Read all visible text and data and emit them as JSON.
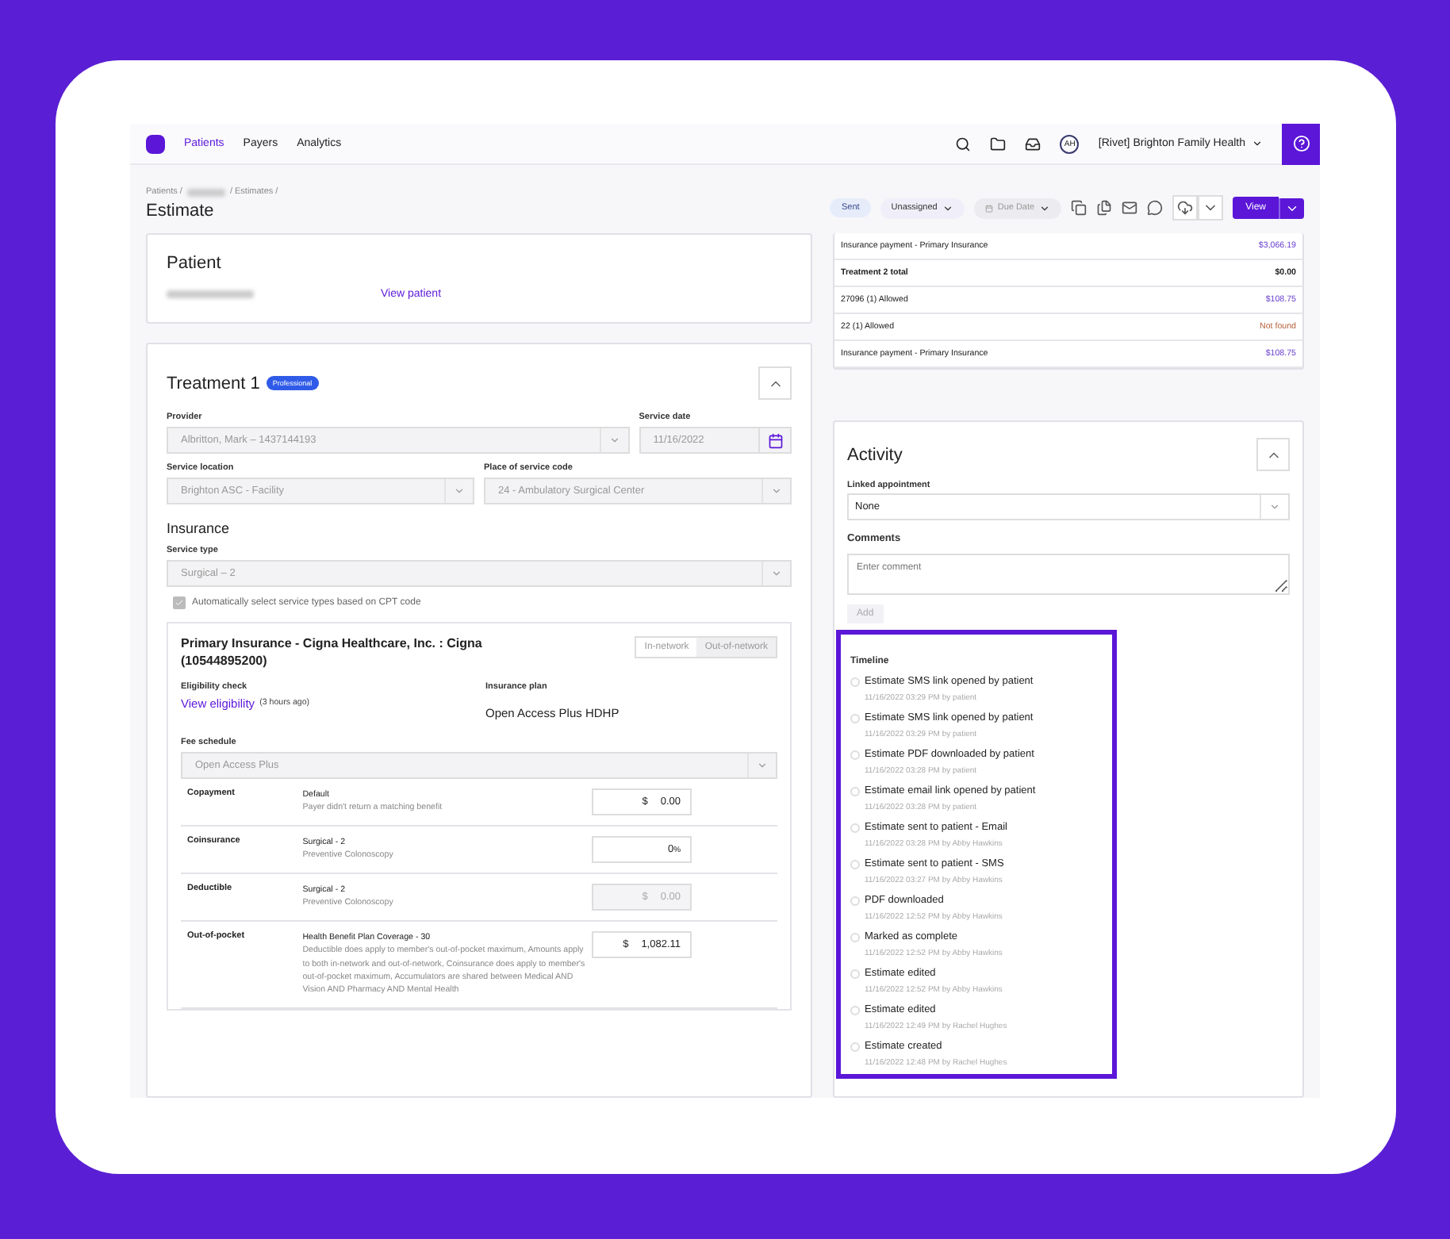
{
  "nav": {
    "items": [
      {
        "label": "Patients",
        "selected": true
      },
      {
        "label": "Payers",
        "selected": false
      },
      {
        "label": "Analytics",
        "selected": false
      }
    ],
    "org": {
      "initials": "AH",
      "name": "[Rivet] Brighton Family Health"
    }
  },
  "header": {
    "breadcrumb": [
      {
        "kind": "link",
        "label": "Patients /"
      },
      {
        "kind": "redacted"
      },
      {
        "kind": "link",
        "label": "/ Estimates /"
      }
    ],
    "title": "Estimate",
    "status": "Sent",
    "assignee": "Unassigned",
    "due_date": {
      "placeholder": "Due Date"
    },
    "view_button": "View"
  },
  "patient": {
    "title": "Patient",
    "link": "View patient"
  },
  "treatment": {
    "title": "Treatment 1",
    "badge": "Professional",
    "expanded": true,
    "provider": {
      "label": "Provider",
      "value": "Albritton, Mark – 1437144193",
      "disabled": true
    },
    "service_date": {
      "label": "Service date",
      "value": "11/16/2022",
      "disabled": true
    },
    "service_location": {
      "label": "Service location",
      "value": "Brighton ASC - Facility",
      "disabled": true
    },
    "place_of_service": {
      "label": "Place of service code",
      "value": "24 - Ambulatory Surgical Center",
      "disabled": true
    },
    "insurance_title": "Insurance",
    "service_type": {
      "label": "Service type",
      "value": "Surgical – 2",
      "disabled": true
    },
    "auto_select": {
      "label": "Automatically select service types based on CPT code",
      "checked": true,
      "disabled": true
    }
  },
  "insurance": {
    "title": "Primary Insurance - Cigna Healthcare, Inc. : Cigna (10544895200)",
    "network": [
      {
        "label": "In-network",
        "selected": false
      },
      {
        "label": "Out-of-network",
        "selected": true
      }
    ],
    "eligibility_label": "Eligibility check",
    "eligibility_link": "View eligibility",
    "eligibility_age": "(3 hours ago)",
    "plan_label": "Insurance plan",
    "plan": "Open Access Plus HDHP",
    "fee_schedule": {
      "label": "Fee schedule",
      "value": "Open Access Plus",
      "disabled": true
    },
    "benefits": [
      {
        "label": "Copayment",
        "name": "Default",
        "detail": "Payer didn't return a matching benefit",
        "prefix": "$",
        "amount": "0.00",
        "disabled": false
      },
      {
        "label": "Coinsurance",
        "name": "Surgical - 2",
        "detail": "Preventive Colonoscopy",
        "amount": "0",
        "suffix": "%",
        "disabled": false
      },
      {
        "label": "Deductible",
        "name": "Surgical - 2",
        "detail": "Preventive Colonoscopy",
        "prefix": "$",
        "amount": "0.00",
        "disabled": true
      },
      {
        "label": "Out-of-pocket",
        "name": "Health Benefit Plan Coverage - 30",
        "detail": "Deductible does apply to member's out-of-pocket maximum, Amounts apply to both in-network and out-of-network, Coinsurance does apply to member's out-of-pocket maximum, Accumulators are shared between Medical AND Vision AND Pharmacy AND Mental Health",
        "prefix": "$",
        "amount": "1,082.11",
        "disabled": false
      }
    ]
  },
  "summary": [
    {
      "kind": "line",
      "label": "Insurance payment - Primary Insurance",
      "value": "$3,066.19",
      "color": "#6a40d0"
    },
    {
      "kind": "total",
      "label": "Treatment 2 total",
      "value": "$0.00",
      "color": "#222222"
    },
    {
      "kind": "line",
      "label": "27096 (1) Allowed",
      "value": "$108.75",
      "color": "#6a40d0"
    },
    {
      "kind": "line",
      "label": "22 (1) Allowed",
      "value": "Not found",
      "color": "#b5603a"
    },
    {
      "kind": "line",
      "label": "Insurance payment - Primary Insurance",
      "value": "$108.75",
      "color": "#6a40d0"
    }
  ],
  "activity": {
    "title": "Activity",
    "expanded": true,
    "linked_label": "Linked appointment",
    "linked_value": "None",
    "comments_label": "Comments",
    "comment_placeholder": "Enter comment",
    "add_button": {
      "label": "Add",
      "disabled": true
    },
    "timeline_title": "Timeline",
    "highlighted": true,
    "events": [
      {
        "title": "Estimate SMS link opened by patient",
        "meta": "11/16/2022 03:29 PM by patient"
      },
      {
        "title": "Estimate SMS link opened by patient",
        "meta": "11/16/2022 03:29 PM by patient"
      },
      {
        "title": "Estimate PDF downloaded by patient",
        "meta": "11/16/2022 03:28 PM by patient"
      },
      {
        "title": "Estimate email link opened by patient",
        "meta": "11/16/2022 03:28 PM by patient"
      },
      {
        "title": "Estimate sent to patient - Email",
        "meta": "11/16/2022 03:28 PM by Abby Hawkins"
      },
      {
        "title": "Estimate sent to patient - SMS",
        "meta": "11/16/2022 03:27 PM by Abby Hawkins"
      },
      {
        "title": "PDF downloaded",
        "meta": "11/16/2022 12:52 PM by Abby Hawkins"
      },
      {
        "title": "Marked as complete",
        "meta": "11/16/2022 12:52 PM by Abby Hawkins"
      },
      {
        "title": "Estimate edited",
        "meta": "11/16/2022 12:52 PM by Abby Hawkins"
      },
      {
        "title": "Estimate edited",
        "meta": "11/16/2022 12:49 PM by Rachel Hughes"
      },
      {
        "title": "Estimate created",
        "meta": "11/16/2022 12:48 PM by Rachel Hughes"
      }
    ]
  }
}
